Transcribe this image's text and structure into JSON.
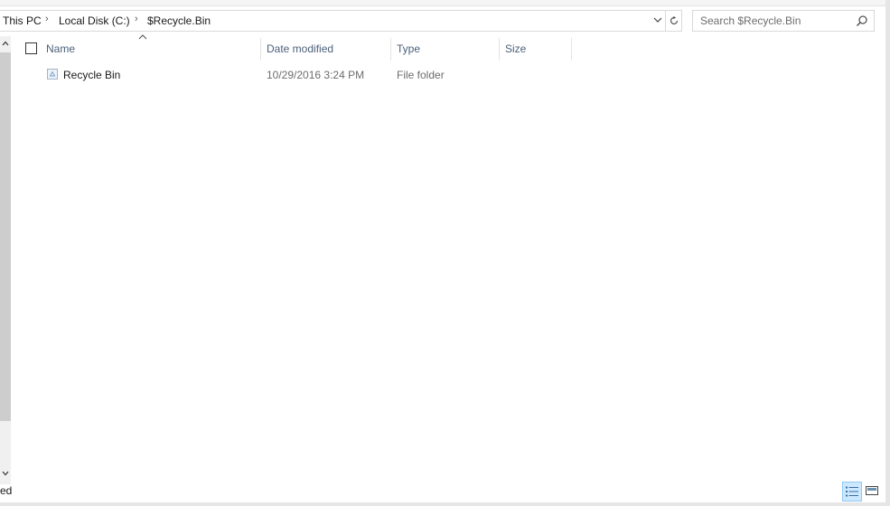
{
  "address_bar": {
    "breadcrumbs": [
      "This PC",
      "Local Disk (C:)",
      "$Recycle.Bin"
    ]
  },
  "search": {
    "placeholder": "Search $Recycle.Bin"
  },
  "columns": {
    "name": "Name",
    "date_modified": "Date modified",
    "type": "Type",
    "size": "Size"
  },
  "files": [
    {
      "name": "Recycle Bin",
      "date_modified": "10/29/2016 3:24 PM",
      "type": "File folder",
      "size": ""
    }
  ],
  "status_bar": {
    "text": "ed"
  },
  "icons": {
    "refresh": "refresh-icon",
    "search": "search-icon",
    "folder": "recycle-bin-folder-icon",
    "view_details": "details-view-icon",
    "view_tiles": "large-icons-view-icon"
  },
  "colors": {
    "header_text": "#4c607a",
    "selected_view": "#cce8ff"
  }
}
